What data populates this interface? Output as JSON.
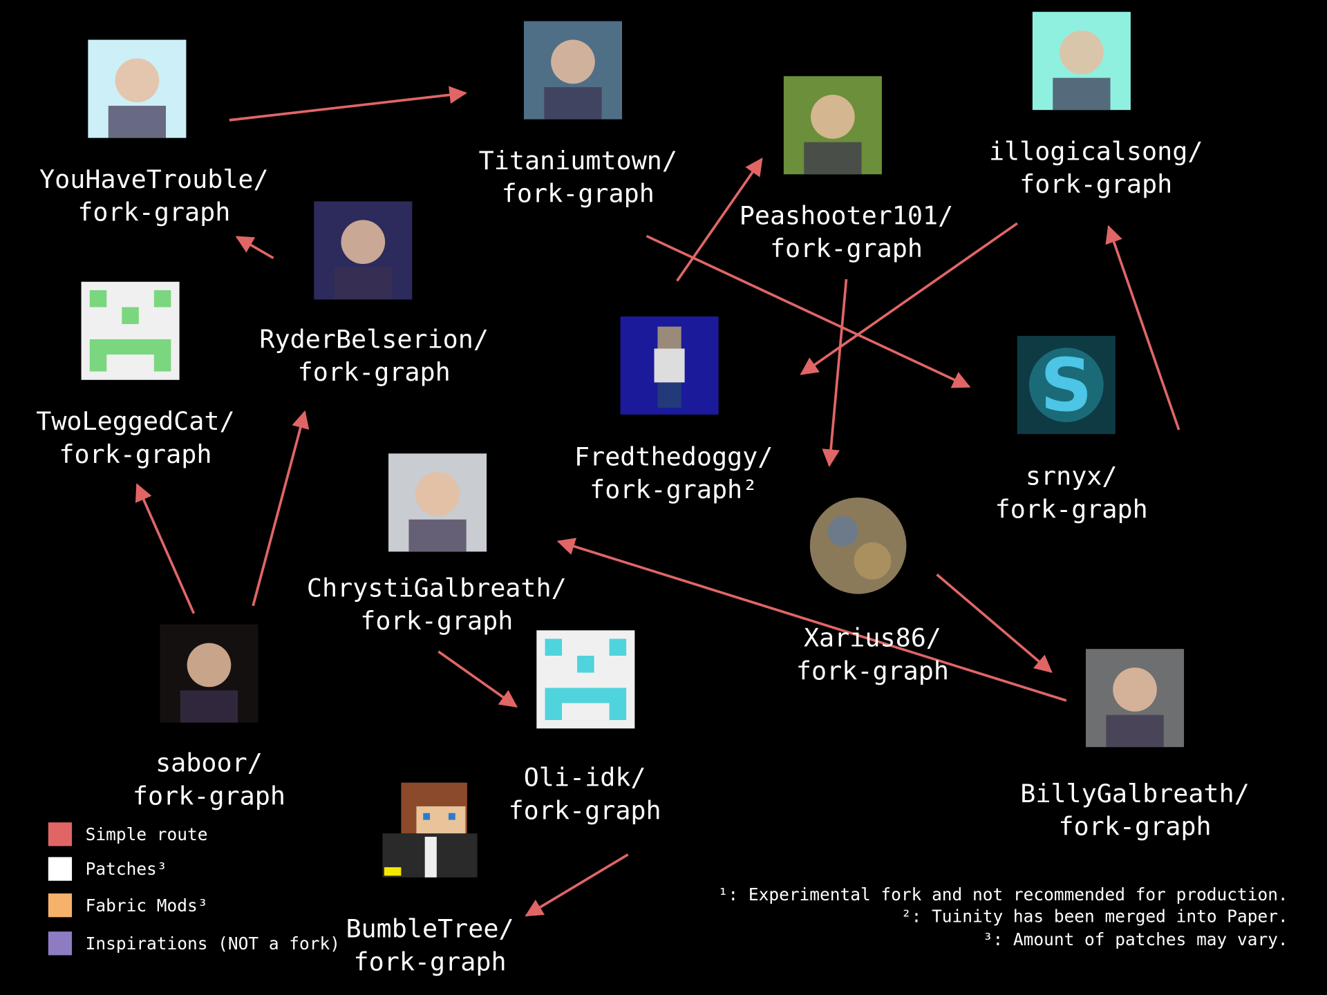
{
  "colors": {
    "edge": "#e06666",
    "background": "#000000"
  },
  "nodes": [
    {
      "id": "youhavetrouble",
      "line1": "YouHaveTrouble/",
      "line2": "fork-graph",
      "avatar": "cartoon-boy-avatar",
      "color": "#cdeff7"
    },
    {
      "id": "titaniumtown",
      "line1": "Titaniumtown/",
      "line2": "fork-graph",
      "avatar": "rocket-avatar",
      "color": "#4f6f86"
    },
    {
      "id": "peashooter101",
      "line1": "Peashooter101/",
      "line2": "fork-graph",
      "avatar": "minecraft-scene-avatar",
      "color": "#6b8f3a"
    },
    {
      "id": "illogicalsong",
      "line1": "illogicalsong/",
      "line2": "fork-graph",
      "avatar": "headphones-girl-avatar",
      "color": "#8ff0e0"
    },
    {
      "id": "ryderbelserion",
      "line1": "RyderBelserion/",
      "line2": "fork-graph",
      "avatar": "anime-girl-avatar",
      "color": "#2d2a5c"
    },
    {
      "id": "twoleggedcat",
      "line1": "TwoLeggedCat/",
      "line2": "fork-graph",
      "avatar": "creeper-face-avatar",
      "color": "#f0f0f0"
    },
    {
      "id": "fredthedoggy",
      "line1": "Fredthedoggy/",
      "line2": "fork-graph²",
      "avatar": "pixel-character-avatar",
      "color": "#1a1a9a"
    },
    {
      "id": "srnyx",
      "line1": "srnyx/",
      "line2": "fork-graph",
      "avatar": "s-logo-avatar",
      "color": "#0e3a44"
    },
    {
      "id": "chrystigalbreath",
      "line1": "ChrystiGalbreath/",
      "line2": "fork-graph",
      "avatar": "woman-photo-avatar",
      "color": "#c9ccd0"
    },
    {
      "id": "xarius86",
      "line1": "Xarius86/",
      "line2": "fork-graph",
      "avatar": "planet-avatar",
      "color": "#8a7a5a"
    },
    {
      "id": "saboor",
      "line1": "saboor/",
      "line2": "fork-graph",
      "avatar": "selfie-photo-avatar",
      "color": "#151010"
    },
    {
      "id": "oli-idk",
      "line1": "Oli-idk/",
      "line2": "fork-graph",
      "avatar": "cyan-pixel-logo-avatar",
      "color": "#f0f0f0"
    },
    {
      "id": "billygalbreath",
      "line1": "BillyGalbreath/",
      "line2": "fork-graph",
      "avatar": "man-photo-avatar",
      "color": "#6d6f70"
    },
    {
      "id": "bumbletree",
      "line1": "BumbleTree/",
      "line2": "fork-graph",
      "avatar": "minecraft-skin-avatar",
      "color": "#2a2a2a"
    }
  ],
  "edges": [
    [
      "youhavetrouble",
      "titaniumtown"
    ],
    [
      "ryderbelserion",
      "youhavetrouble"
    ],
    [
      "fredthedoggy",
      "peashooter101"
    ],
    [
      "titaniumtown",
      "srnyx"
    ],
    [
      "illogicalsong",
      "fredthedoggy"
    ],
    [
      "peashooter101",
      "xarius86"
    ],
    [
      "srnyx",
      "illogicalsong"
    ],
    [
      "saboor",
      "twoleggedcat"
    ],
    [
      "saboor",
      "ryderbelserion"
    ],
    [
      "chrystigalbreath",
      "oli-idk"
    ],
    [
      "xarius86",
      "billygalbreath"
    ],
    [
      "billygalbreath",
      "chrystigalbreath"
    ],
    [
      "oli-idk",
      "bumbletree"
    ]
  ],
  "legend": [
    {
      "label": "Simple route",
      "color": "#e06666"
    },
    {
      "label": "Patches³",
      "color": "#ffffff"
    },
    {
      "label": "Fabric Mods³",
      "color": "#f6b26b"
    },
    {
      "label": "Inspirations (NOT a fork)",
      "color": "#8e7cc3"
    }
  ],
  "footnotes": [
    "¹: Experimental fork and not recommended for production.",
    "²: Tuinity has been merged into Paper.",
    "³: Amount of patches may vary."
  ]
}
